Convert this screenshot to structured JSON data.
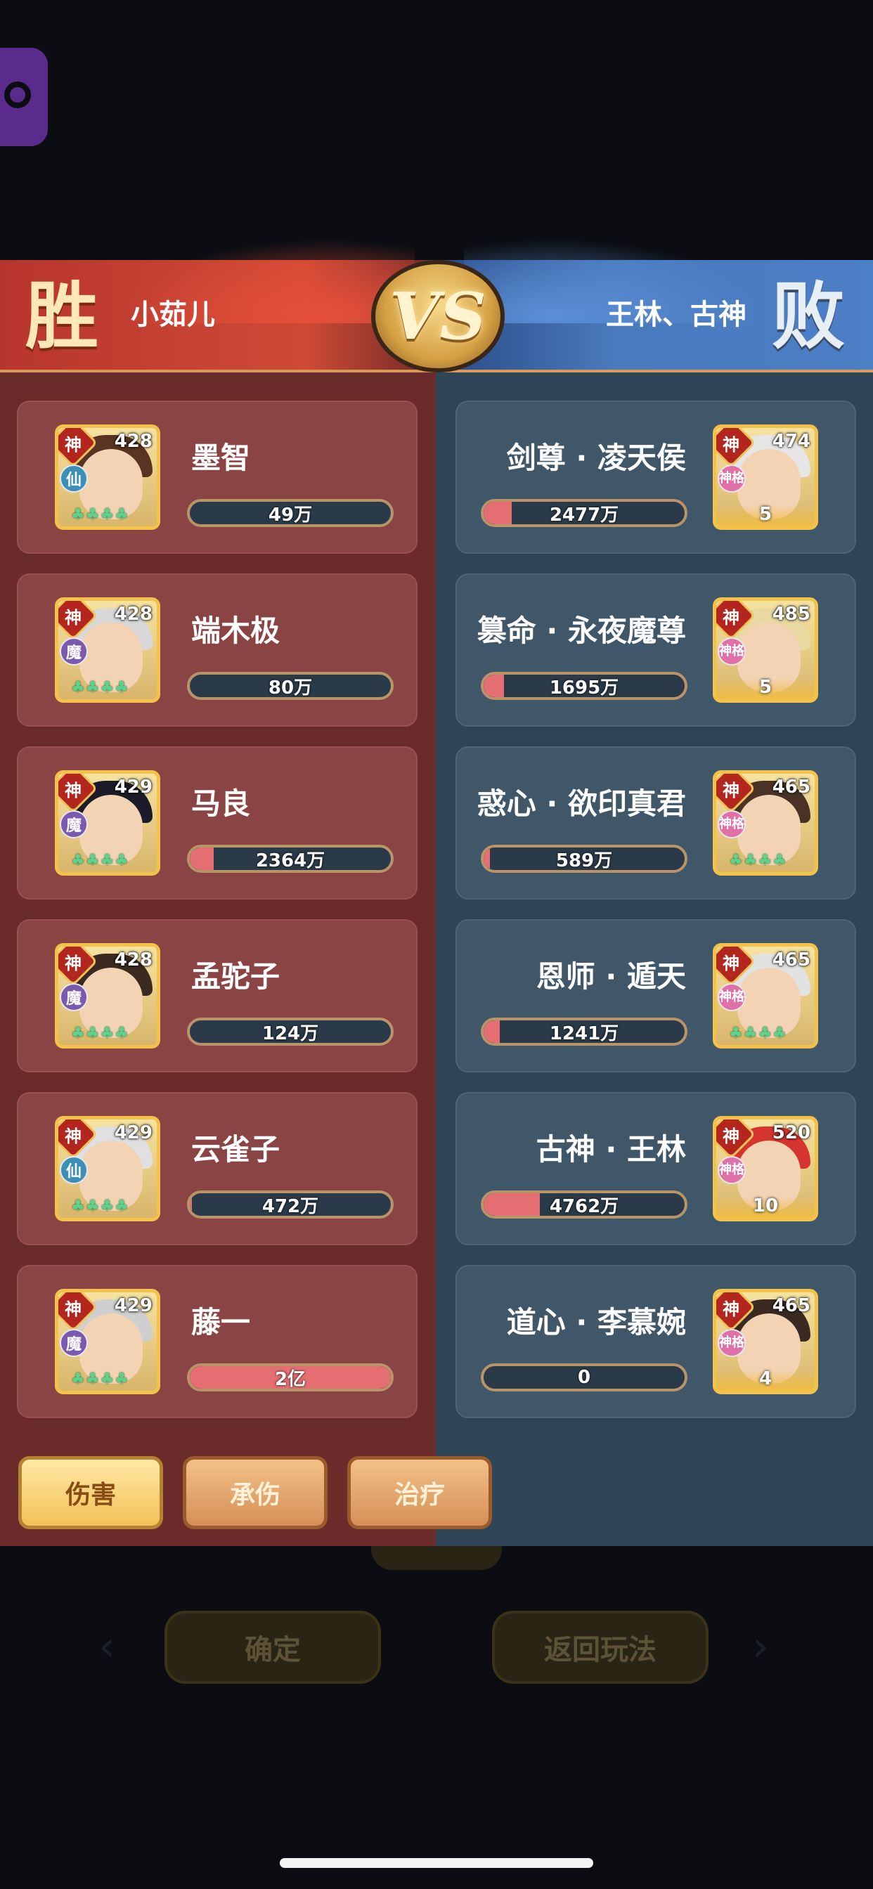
{
  "result": {
    "left": "胜",
    "right": "败"
  },
  "teams": {
    "left": "小茹儿",
    "right": "王林、古神"
  },
  "vs_label": "VS",
  "left_heroes": [
    {
      "name": "墨智",
      "level": "428",
      "god": "神",
      "class": "仙",
      "class_type": "xian",
      "value": "49万",
      "fill": 0.0,
      "hair": "#5a3322"
    },
    {
      "name": "端木极",
      "level": "428",
      "god": "神",
      "class": "魔",
      "class_type": "mo",
      "value": "80万",
      "fill": 0.0,
      "hair": "#d8d8d8"
    },
    {
      "name": "马良",
      "level": "429",
      "god": "神",
      "class": "魔",
      "class_type": "mo",
      "value": "2364万",
      "fill": 0.12,
      "hair": "#1b1b2a"
    },
    {
      "name": "孟驼子",
      "level": "428",
      "god": "神",
      "class": "魔",
      "class_type": "mo",
      "value": "124万",
      "fill": 0.0,
      "hair": "#3a2a20"
    },
    {
      "name": "云雀子",
      "level": "429",
      "god": "神",
      "class": "仙",
      "class_type": "xian",
      "value": "472万",
      "fill": 0.01,
      "hair": "#e0e0e0"
    },
    {
      "name": "藤一",
      "level": "429",
      "god": "神",
      "class": "魔",
      "class_type": "mo",
      "value": "2亿",
      "fill": 1.0,
      "hair": "#cfcfcf"
    }
  ],
  "right_heroes": [
    {
      "name": "剑尊 · 凌天侯",
      "level": "474",
      "god": "神",
      "class": "神格",
      "value": "2477万",
      "fill": 0.14,
      "rank": "5",
      "hair": "#e6e6e6"
    },
    {
      "name": "篡命 · 永夜魔尊",
      "level": "485",
      "god": "神",
      "class": "神格",
      "value": "1695万",
      "fill": 0.1,
      "rank": "5",
      "hair": "#e8d9a0"
    },
    {
      "name": "惑心 · 欲印真君",
      "level": "465",
      "god": "神",
      "class": "神格",
      "value": "589万",
      "fill": 0.03,
      "rank": "",
      "hair": "#4a3326"
    },
    {
      "name": "恩师 · 遁天",
      "level": "465",
      "god": "神",
      "class": "神格",
      "value": "1241万",
      "fill": 0.08,
      "rank": "",
      "hair": "#e2e2e2"
    },
    {
      "name": "古神 · 王林",
      "level": "520",
      "god": "神",
      "class": "神格",
      "value": "4762万",
      "fill": 0.28,
      "rank": "10",
      "hair": "#d6352f"
    },
    {
      "name": "道心 · 李慕婉",
      "level": "465",
      "god": "神",
      "class": "神格",
      "value": "0",
      "fill": 0.0,
      "rank": "4",
      "hair": "#3a2a22"
    }
  ],
  "tabs": [
    {
      "label": "伤害",
      "active": true
    },
    {
      "label": "承伤",
      "active": false
    },
    {
      "label": "治疗",
      "active": false
    }
  ],
  "background_buttons": {
    "confirm": "确定",
    "back": "返回玩法"
  },
  "colors": {
    "left_panel": "#6b2b2b",
    "right_panel": "#2f4456",
    "bar_fill": "#e46e72",
    "gold": "#f2c24a"
  },
  "icons": {
    "side_tab": "gamepad-icon",
    "stars": "leaf-star-icon"
  }
}
